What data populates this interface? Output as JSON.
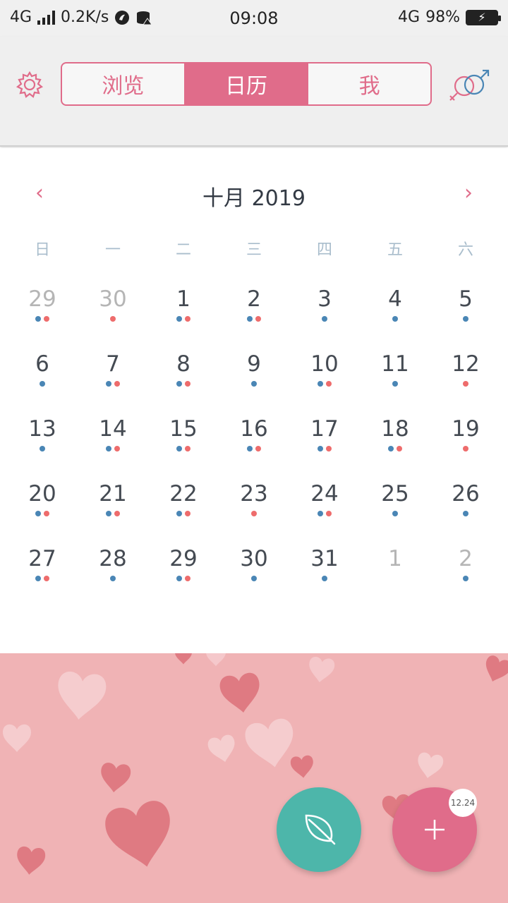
{
  "status_bar": {
    "network": "4G",
    "speed": "0.2K/s",
    "time": "09:08",
    "network_right": "4G",
    "battery": "98%"
  },
  "header": {
    "tabs": [
      {
        "label": "浏览",
        "active": false
      },
      {
        "label": "日历",
        "active": true
      },
      {
        "label": "我",
        "active": false
      }
    ],
    "accent_color": "#e06c8a"
  },
  "calendar": {
    "month_title": "十月 2019",
    "prev_symbol": "‹",
    "next_symbol": "›",
    "weekdays": [
      "日",
      "一",
      "二",
      "三",
      "四",
      "五",
      "六"
    ],
    "weeks": [
      [
        {
          "day": "29",
          "muted": true,
          "dots": [
            "blue",
            "red"
          ]
        },
        {
          "day": "30",
          "muted": true,
          "dots": [
            "red"
          ]
        },
        {
          "day": "1",
          "muted": false,
          "dots": [
            "blue",
            "red"
          ]
        },
        {
          "day": "2",
          "muted": false,
          "dots": [
            "blue",
            "red"
          ]
        },
        {
          "day": "3",
          "muted": false,
          "dots": [
            "blue"
          ]
        },
        {
          "day": "4",
          "muted": false,
          "dots": [
            "blue"
          ]
        },
        {
          "day": "5",
          "muted": false,
          "dots": [
            "blue"
          ]
        }
      ],
      [
        {
          "day": "6",
          "muted": false,
          "dots": [
            "blue"
          ]
        },
        {
          "day": "7",
          "muted": false,
          "dots": [
            "blue",
            "red"
          ]
        },
        {
          "day": "8",
          "muted": false,
          "dots": [
            "blue",
            "red"
          ]
        },
        {
          "day": "9",
          "muted": false,
          "dots": [
            "blue"
          ]
        },
        {
          "day": "10",
          "muted": false,
          "dots": [
            "blue",
            "red"
          ]
        },
        {
          "day": "11",
          "muted": false,
          "dots": [
            "blue"
          ]
        },
        {
          "day": "12",
          "muted": false,
          "dots": [
            "red"
          ]
        }
      ],
      [
        {
          "day": "13",
          "muted": false,
          "dots": [
            "blue"
          ]
        },
        {
          "day": "14",
          "muted": false,
          "dots": [
            "blue",
            "red"
          ]
        },
        {
          "day": "15",
          "muted": false,
          "dots": [
            "blue",
            "red"
          ]
        },
        {
          "day": "16",
          "muted": false,
          "dots": [
            "blue",
            "red"
          ]
        },
        {
          "day": "17",
          "muted": false,
          "dots": [
            "blue",
            "red"
          ]
        },
        {
          "day": "18",
          "muted": false,
          "dots": [
            "blue",
            "red"
          ]
        },
        {
          "day": "19",
          "muted": false,
          "dots": [
            "red"
          ]
        }
      ],
      [
        {
          "day": "20",
          "muted": false,
          "dots": [
            "blue",
            "red"
          ]
        },
        {
          "day": "21",
          "muted": false,
          "dots": [
            "blue",
            "red"
          ]
        },
        {
          "day": "22",
          "muted": false,
          "dots": [
            "blue",
            "red"
          ]
        },
        {
          "day": "23",
          "muted": false,
          "dots": [
            "red"
          ]
        },
        {
          "day": "24",
          "muted": false,
          "dots": [
            "blue",
            "red"
          ]
        },
        {
          "day": "25",
          "muted": false,
          "dots": [
            "blue"
          ]
        },
        {
          "day": "26",
          "muted": false,
          "dots": [
            "blue"
          ]
        }
      ],
      [
        {
          "day": "27",
          "muted": false,
          "dots": [
            "blue",
            "red"
          ]
        },
        {
          "day": "28",
          "muted": false,
          "dots": [
            "blue"
          ]
        },
        {
          "day": "29",
          "muted": false,
          "dots": [
            "blue",
            "red"
          ]
        },
        {
          "day": "30",
          "muted": false,
          "dots": [
            "blue"
          ]
        },
        {
          "day": "31",
          "muted": false,
          "dots": [
            "blue"
          ]
        },
        {
          "day": "1",
          "muted": true,
          "dots": []
        },
        {
          "day": "2",
          "muted": true,
          "dots": [
            "blue"
          ]
        }
      ]
    ]
  },
  "bottom": {
    "leaf_button_icon": "leaf-icon",
    "add_button_icon": "plus-icon",
    "badge": "12.24",
    "background_color": "#f0b3b5"
  }
}
